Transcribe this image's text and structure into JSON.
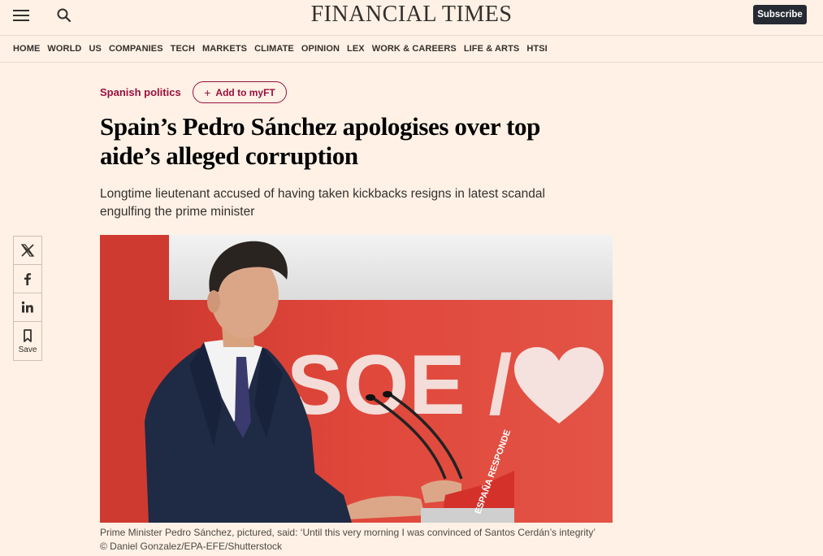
{
  "header": {
    "logo": "FINANCIAL TIMES",
    "subscribe_label": "Subscribe"
  },
  "nav": {
    "items": [
      "HOME",
      "WORLD",
      "US",
      "COMPANIES",
      "TECH",
      "MARKETS",
      "CLIMATE",
      "OPINION",
      "LEX",
      "WORK & CAREERS",
      "LIFE & ARTS",
      "HTSI"
    ]
  },
  "article": {
    "topic": "Spanish politics",
    "myft_label": "Add to myFT",
    "headline": "Spain’s Pedro Sánchez apologises over top aide’s alleged corruption",
    "standfirst": "Longtime lieutenant accused of having taken kickbacks resigns in latest scandal engulfing the prime minister",
    "image": {
      "backdrop_text": "SOE /",
      "podium_text": "ESPAÑA RESPONDE"
    },
    "caption": "Prime Minister Pedro Sánchez, pictured, said: ‘Until this very morning I was convinced of Santos Cerdán’s integrity’",
    "credit": "© Daniel Gonzalez/EPA-EFE/Shutterstock"
  },
  "share": {
    "save_label": "Save",
    "icons": [
      "x-icon",
      "facebook-icon",
      "linkedin-icon",
      "bookmark-icon"
    ]
  },
  "colors": {
    "background": "#fff1e5",
    "accent": "#990f3d",
    "subscribe_bg": "#262a33",
    "red_backdrop": "#d9463c"
  }
}
